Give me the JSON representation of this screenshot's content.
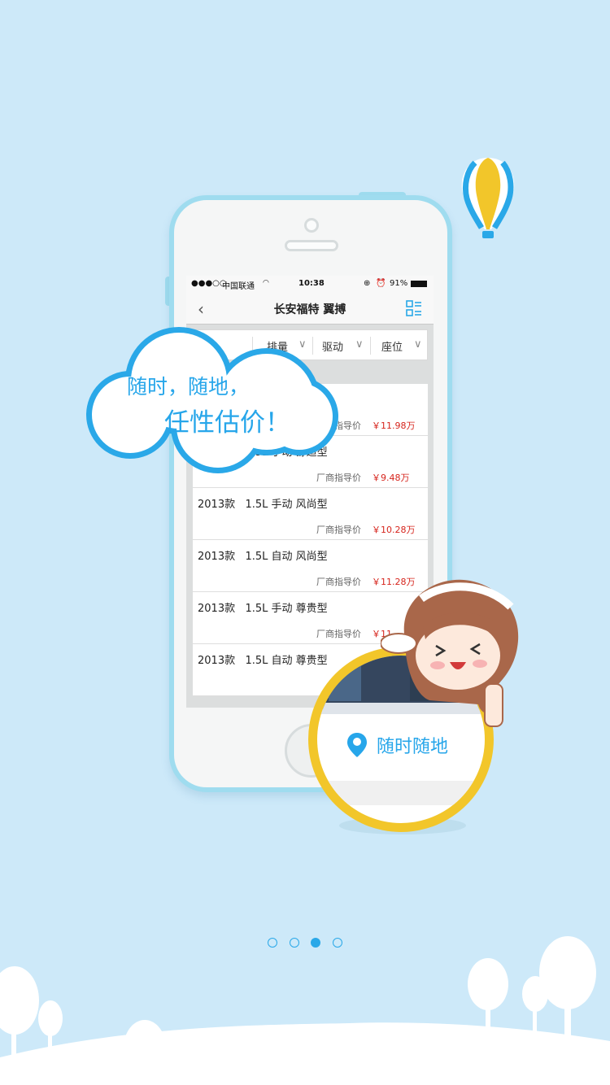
{
  "status_bar": {
    "signal": "●●●○○",
    "carrier": "中国联通",
    "time": "10:38",
    "battery": "91%"
  },
  "nav": {
    "title": "长安福特 翼搏",
    "back_icon": "chevron-left-icon",
    "menu_icon": "list-menu-icon"
  },
  "filters": [
    "排量",
    "驱动",
    "座位"
  ],
  "rows": [
    {
      "name": "",
      "label": "厂商指导价",
      "price": "￥11.98万"
    },
    {
      "name": "2013款   1.5L 手动 舒适型",
      "label": "厂商指导价",
      "price": "￥9.48万"
    },
    {
      "name": "2013款   1.5L 手动 风尚型",
      "label": "厂商指导价",
      "price": "￥10.28万"
    },
    {
      "name": "2013款   1.5L 自动 风尚型",
      "label": "厂商指导价",
      "price": "￥11.28万"
    },
    {
      "name": "2013款   1.5L 手动 尊贵型",
      "label": "厂商指导价",
      "price": "￥11"
    },
    {
      "name": "2013款   1.5L 自动 尊贵型",
      "label": "",
      "price": ""
    }
  ],
  "cloud": {
    "line1": "随时，随地，",
    "line2": "任性估价！"
  },
  "badge": {
    "text": "随时随地",
    "icon": "location-pin-icon"
  },
  "pagination": {
    "count": 4,
    "active_index": 2
  },
  "colors": {
    "accent": "#27a6ea",
    "background": "#cde9f9",
    "price": "#d6241c",
    "ring": "#f2c62a"
  }
}
